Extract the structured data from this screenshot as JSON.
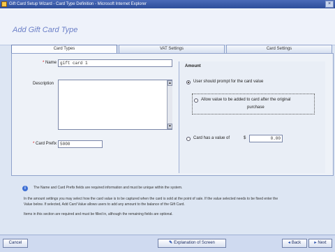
{
  "window": {
    "title": "Gift Card Setup Wizard - Card Type Definition - Microsoft Internet Explorer",
    "close_glyph": "×"
  },
  "page": {
    "title": "Add Gift Card Type"
  },
  "tabs": [
    {
      "label": "Card Types"
    },
    {
      "label": "VAT Settings"
    },
    {
      "label": "Card Settings"
    }
  ],
  "form": {
    "name_label": "Name",
    "name_value": "gift card 1",
    "description_label": "Description",
    "description_value": "",
    "card_prefix_label": "Card Prefix",
    "card_prefix_value": "5000"
  },
  "group": {
    "title": "Amount",
    "option1": "User should prompt for the card value",
    "option2_line1": "Allow value to be added to card after the original",
    "option2_line2": "purchase",
    "option3": "Card has a value of",
    "currency_symbol": "$",
    "option3_value": "0.00"
  },
  "info": {
    "line1": "The Name and Card Prefix fields are required information and must be unique within the system.",
    "line2": "In the amount settings you may select how the card value is to be captured when the card is sold at the point of sale. If the value selected needs to be fixed enter the",
    "line3": "Value below. If selected, Add Card Value allows users to add any amount to the balance of the Gift Card.",
    "line4": "Items in this section are required and must be filled in, although the remaining fields are optional."
  },
  "footer": {
    "cancel_label": "Cancel",
    "help_label": "Explanation of Screen",
    "back_label": "Back",
    "next_label": "Next"
  },
  "colors": {
    "title_bar": "#2c4d9a",
    "page_title": "#6b7fc7",
    "required": "#d01010",
    "info_icon": "#3d6fd4"
  }
}
